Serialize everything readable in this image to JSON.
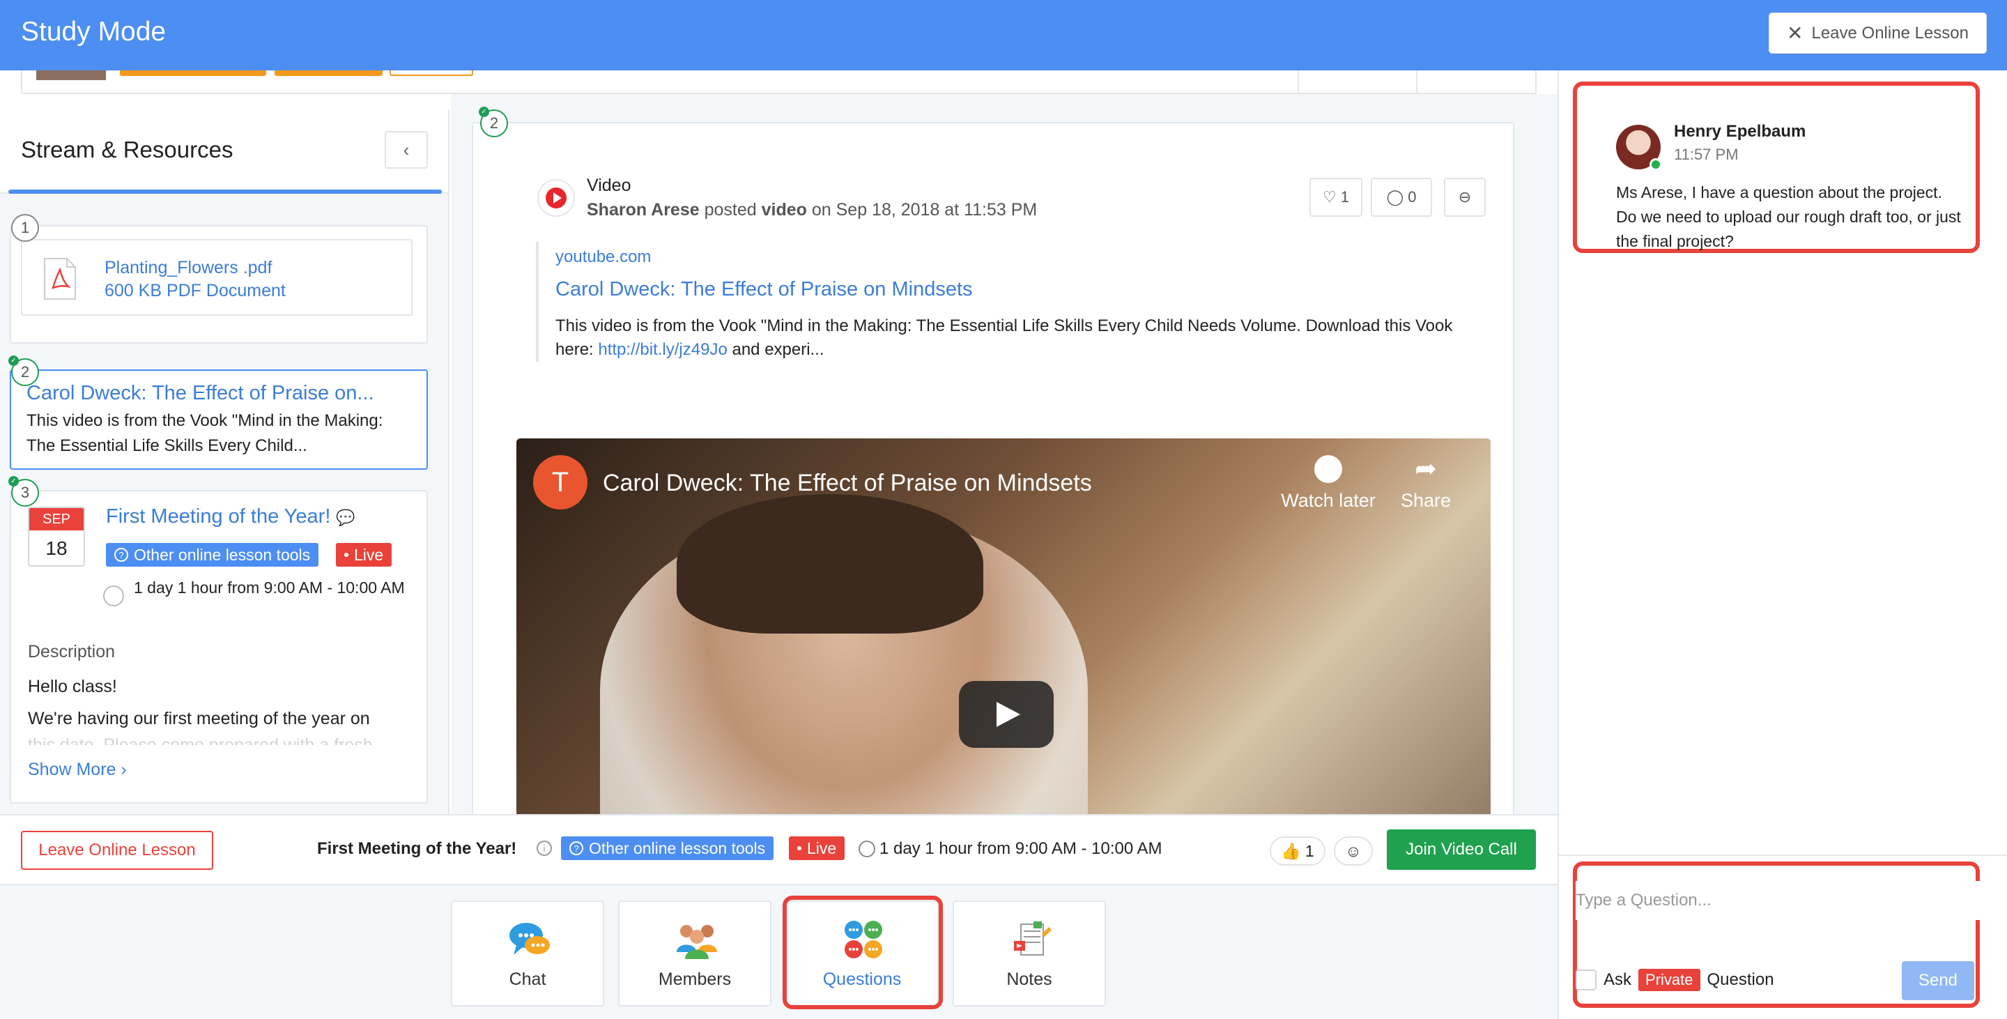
{
  "app": {
    "title": "Study Mode",
    "leave_label": "Leave Online Lesson"
  },
  "sidebar": {
    "title": "Stream & Resources",
    "items": [
      {
        "num": "1",
        "file_name": "Planting_Flowers .pdf",
        "file_size": "600 KB PDF Document"
      },
      {
        "num": "2",
        "title": "Carol Dweck: The Effect of Praise on...",
        "desc": "This video is from the Vook \"Mind in the Making: The Essential Life Skills Every Child..."
      },
      {
        "num": "3",
        "month": "SEP",
        "day": "18",
        "title": "First Meeting of the Year!",
        "tools_badge": "Other online lesson tools",
        "live_badge": "Live",
        "time": "1 day 1 hour from 9:00 AM - 10:00 AM",
        "desc_heading": "Description",
        "desc_line1": "Hello class!",
        "desc_line2": "We're having our first meeting of the year on",
        "desc_line3": "this date. Please come prepared with a fresh",
        "show_more": "Show More"
      }
    ]
  },
  "post": {
    "num": "2",
    "type": "Video",
    "author": "Sharon Arese",
    "verb": "posted",
    "object": "video",
    "date": "on Sep 18, 2018 at 11:53 PM",
    "likes": "1",
    "comments": "0",
    "link_site": "youtube.com",
    "link_title": "Carol Dweck: The Effect of Praise on Mindsets",
    "link_desc_pre": "This video is from the Vook \"Mind in the Making: The Essential Life Skills Every Child Needs Volume. Download this Vook here: ",
    "link_url": "http://bit.ly/jz49Jo",
    "link_desc_post": " and experi...",
    "video": {
      "avatar_letter": "T",
      "title": "Carol Dweck: The Effect of Praise on Mindsets",
      "watch_later": "Watch later",
      "share": "Share"
    }
  },
  "event_bar": {
    "leave_label": "Leave Online Lesson",
    "title": "First Meeting of the Year!",
    "tools_badge": "Other online lesson tools",
    "live_badge": "Live",
    "time": "1 day 1 hour from 9:00 AM - 10:00 AM",
    "thumbs_count": "1",
    "join_label": "Join Video Call"
  },
  "tabs": [
    {
      "label": "Chat",
      "icon": "chat-icon"
    },
    {
      "label": "Members",
      "icon": "members-icon"
    },
    {
      "label": "Questions",
      "icon": "questions-icon",
      "active": true
    },
    {
      "label": "Notes",
      "icon": "notes-icon"
    }
  ],
  "questions": {
    "message": {
      "name": "Henry Epelbaum",
      "time": "11:57 PM",
      "text": "Ms Arese, I have a question about the project. Do we need to upload our rough draft too, or just the final project?"
    },
    "input_placeholder": "Type a Question...",
    "ask_label": "Ask",
    "private_label": "Private",
    "question_label": "Question",
    "send_label": "Send"
  },
  "colors": {
    "brand": "#4c8ef1",
    "live": "#e8423b",
    "join": "#20a14f",
    "highlight": "#e8423b"
  }
}
